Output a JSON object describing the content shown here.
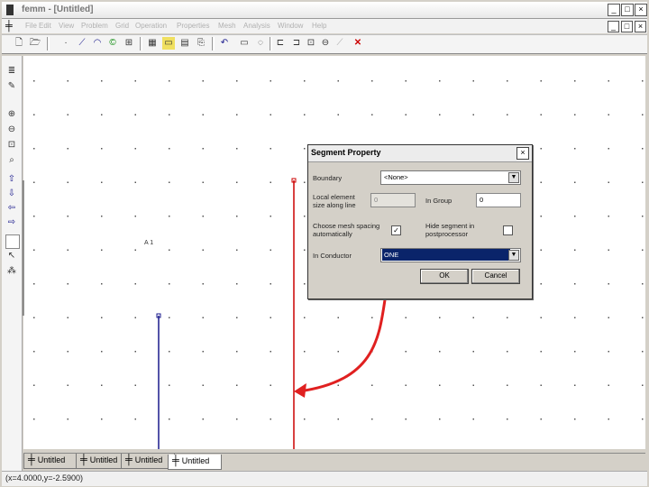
{
  "window": {
    "title": "femm - [Untitled]",
    "app_icon": "femm-app-icon"
  },
  "window_controls": {
    "minimize": "_",
    "restore": "□",
    "close": "×"
  },
  "mdi_controls": {
    "minimize": "_",
    "restore": "□",
    "close": "×"
  },
  "menu": [
    "File",
    "Edit",
    "View",
    "Problem",
    "Grid",
    "Operation",
    "Properties",
    "Mesh",
    "Analysis",
    "Window",
    "Help"
  ],
  "toolbar": {
    "icons": [
      "new-file-icon",
      "open-file-icon",
      "save-icon",
      "node-mode-icon",
      "segment-mode-icon",
      "arc-mode-icon",
      "block-label-icon",
      "group-mode-icon",
      "mesh-icon",
      "analyze-icon",
      "view-results-icon",
      "undo-icon",
      "copy-icon",
      "move-icon",
      "mirror-icon",
      "scale-icon",
      "rotate-icon",
      "delete-icon"
    ]
  },
  "left_toolbar": {
    "icons": [
      "edit-list-icon",
      "edit-props-icon",
      "zoom-in-icon",
      "zoom-out-icon",
      "zoom-window-icon",
      "zoom-extents-icon",
      "pan-up-icon",
      "pan-down-icon",
      "pan-left-icon",
      "pan-right-icon",
      "blank-icon",
      "pointer-icon",
      "grid-toggle-icon"
    ]
  },
  "canvas": {
    "label": "A 1",
    "colors": {
      "selected_segment": "#cc0000",
      "segment": "#1a1a8c",
      "arrow": "#e02020"
    }
  },
  "tabs": [
    "Untitled",
    "Untitled",
    "Untitled",
    "Untitled"
  ],
  "active_tab": 3,
  "status": "(x=4.0000,y=-2.5900)",
  "dialog": {
    "title": "Segment Property",
    "close": "×",
    "boundary_label": "Boundary",
    "boundary_value": "<None>",
    "local_spacing_label": "Local element size along line",
    "local_spacing_value": "0",
    "in_group_label": "In Group",
    "in_group_value": "0",
    "auto_mesh_label": "Choose mesh spacing automatically",
    "auto_mesh_checked": "✓",
    "hide_segment_label": "Hide segment in postprocessor",
    "in_conductor_label": "In Conductor",
    "in_conductor_value": "ONE",
    "ok_label": "OK",
    "cancel_label": "Cancel"
  }
}
